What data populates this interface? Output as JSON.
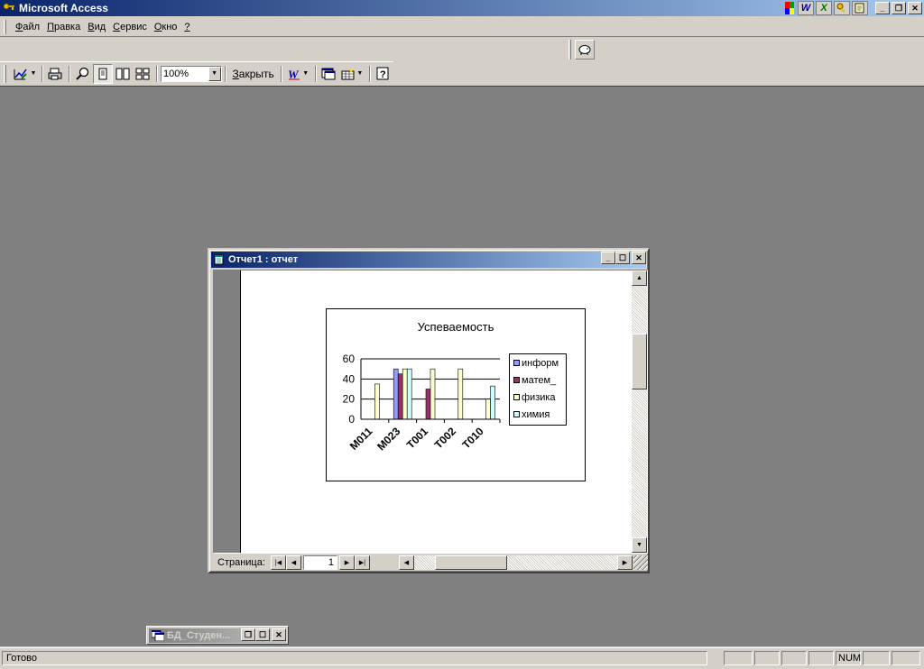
{
  "app": {
    "title": "Microsoft Access"
  },
  "menu": {
    "items": [
      {
        "pre": "",
        "ul": "Ф",
        "post": "айл"
      },
      {
        "pre": "",
        "ul": "П",
        "post": "равка"
      },
      {
        "pre": "",
        "ul": "В",
        "post": "ид"
      },
      {
        "pre": "",
        "ul": "С",
        "post": "ервис"
      },
      {
        "pre": "",
        "ul": "О",
        "post": "кно"
      },
      {
        "pre": "",
        "ul": "?",
        "post": ""
      }
    ]
  },
  "toolbar": {
    "zoom_value": "100%",
    "close_pre": "",
    "close_ul": "З",
    "close_post": "акрыть"
  },
  "report_window": {
    "title": "Отчет1 : отчет",
    "page_label": "Страница:",
    "page_value": "1"
  },
  "chart_data": {
    "type": "bar",
    "title": "Успеваемость",
    "categories": [
      "М011",
      "М023",
      "Т001",
      "Т002",
      "Т010"
    ],
    "ylim": [
      0,
      60
    ],
    "yticks": [
      "0",
      "20",
      "40",
      "60"
    ],
    "series": [
      {
        "name": "информ",
        "color": "#9999ff",
        "values": [
          0,
          50,
          0,
          0,
          0
        ]
      },
      {
        "name": "матем_",
        "color": "#993366",
        "values": [
          0,
          45,
          30,
          0,
          0
        ]
      },
      {
        "name": "физика",
        "color": "#ffffcc",
        "values": [
          35,
          50,
          50,
          50,
          20
        ]
      },
      {
        "name": "химия",
        "color": "#ccffff",
        "values": [
          0,
          50,
          0,
          0,
          33
        ]
      }
    ],
    "grid": true,
    "legend_position": "right"
  },
  "minimized_window": {
    "title": "БД_Студен..."
  },
  "status": {
    "text": "Готово",
    "num": "NUM"
  },
  "colors": {
    "title_active_start": "#0a246a",
    "title_active_end": "#a6caf0",
    "mdi_background": "#808080",
    "face": "#d4d0c8"
  }
}
